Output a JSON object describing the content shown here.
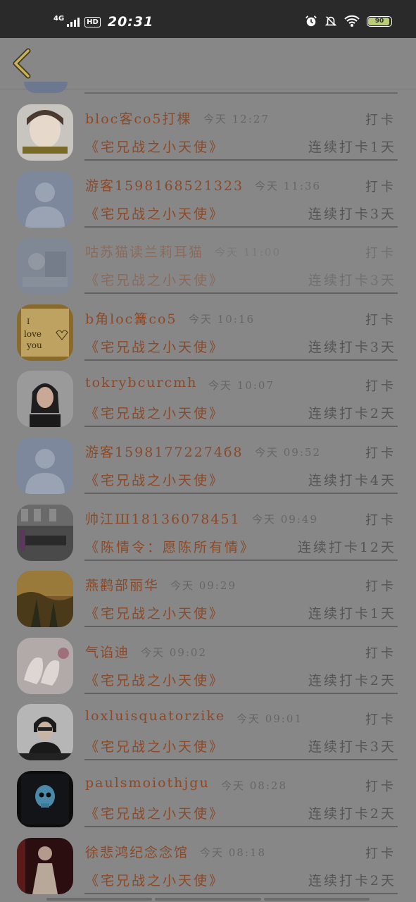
{
  "status_bar": {
    "network": "4G",
    "hd": "HD",
    "time": "20:31",
    "battery_level": "90",
    "icons": [
      "alarm-icon",
      "bell-off-icon",
      "wifi-icon",
      "battery-icon"
    ]
  },
  "header": {
    "back_icon": "chevron-left-icon",
    "back_color": "#c9b15a"
  },
  "colors": {
    "name_and_book": "#8a4a2a",
    "secondary_text": "#666666",
    "background": "#878787"
  },
  "entries": [
    {
      "name": "bloc客co5打棵",
      "time": "今天 12:27",
      "action": "打卡",
      "book": "《宅兄战之小天使》",
      "streak": "连续打卡1天",
      "avatar": "photo-girl-light"
    },
    {
      "name": "游客1598168521323",
      "time": "今天 11:36",
      "action": "打卡",
      "book": "《宅兄战之小天使》",
      "streak": "连续打卡3天",
      "avatar": "default-user"
    },
    {
      "name": "咕苏猫读兰莉耳猫",
      "time": "今天 11:00",
      "action": "打卡",
      "book": "《宅兄战之小天使》",
      "streak": "连续打卡3天",
      "avatar": "photo-blue"
    },
    {
      "name": "b角loc篝co5",
      "time": "今天 10:16",
      "action": "打卡",
      "book": "《宅兄战之小天使》",
      "streak": "连续打卡3天",
      "avatar": "love-you-note"
    },
    {
      "name": "tokrybcurcmh",
      "time": "今天 10:07",
      "action": "打卡",
      "book": "《宅兄战之小天使》",
      "streak": "连续打卡2天",
      "avatar": "photo-portrait"
    },
    {
      "name": "游客15981772274б8",
      "time": "今天 09:52",
      "action": "打卡",
      "book": "《宅兄战之小天使》",
      "streak": "连续打卡4天",
      "avatar": "default-user"
    },
    {
      "name": "帅江Ш18136078451",
      "time": "今天 09:49",
      "action": "打卡",
      "book": "《陈情令：愿陈所有情》",
      "streak": "连续打卡12天",
      "avatar": "photo-room"
    },
    {
      "name": "燕鹳部丽华",
      "time": "今天 09:29",
      "action": "打卡",
      "book": "《宅兄战之小天使》",
      "streak": "连续打卡1天",
      "avatar": "photo-sunset"
    },
    {
      "name": "气谄迪",
      "time": "今天 09:02",
      "action": "打卡",
      "book": "《宅兄战之小天使》",
      "streak": "连续打卡2天",
      "avatar": "photo-shoes"
    },
    {
      "name": "loxluisquatorzike",
      "time": "今天 09:01",
      "action": "打卡",
      "book": "《宅兄战之小天使》",
      "streak": "连续打卡3天",
      "avatar": "photo-boy"
    },
    {
      "name": "paulsmoiothjgu",
      "time": "今天 08:28",
      "action": "打卡",
      "book": "《宅兄战之小天使》",
      "streak": "连续打卡2天",
      "avatar": "skull-glow"
    },
    {
      "name": "徐悲鸿纪念念馆",
      "time": "今天 08:18",
      "action": "打卡",
      "book": "《宅兄战之小天使》",
      "streak": "连续打卡2天",
      "avatar": "photo-costume"
    }
  ]
}
